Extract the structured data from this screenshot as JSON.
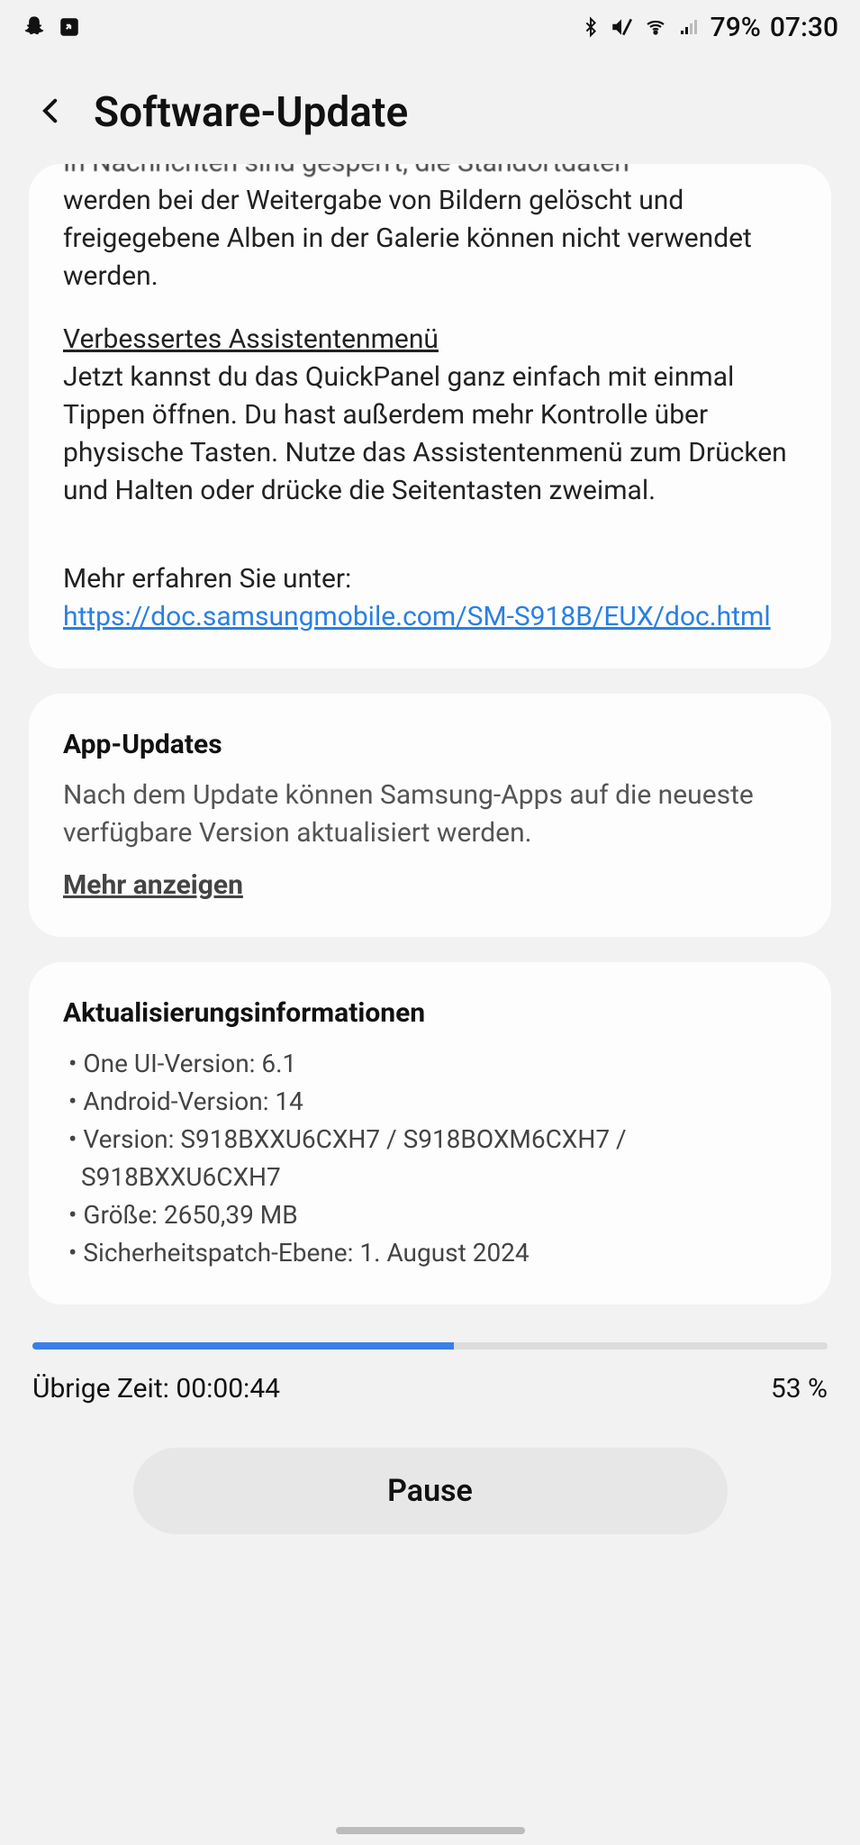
{
  "statusbar": {
    "battery": "79%",
    "time": "07:30"
  },
  "header": {
    "title": "Software-Update"
  },
  "changelog": {
    "clipped_line": "In Nachrichten sind gesperrt, die Standortdaten",
    "p1": "werden bei der Weitergabe von Bildern gelöscht und freigegebene Alben in der Galerie können nicht verwendet werden.",
    "h1": "Verbessertes Assistentenmenü",
    "p2": "Jetzt kannst du das QuickPanel ganz einfach mit einmal Tippen öffnen. Du hast außerdem mehr Kontrolle über physische Tasten. Nutze das Assistentenmenü zum Drücken und Halten oder drücke die Seitentasten zweimal.",
    "more_prefix": "Mehr erfahren Sie unter: ",
    "more_link": "https://doc.samsungmobile.com/SM-S918B/EUX/doc.html"
  },
  "appupdates": {
    "title": "App-Updates",
    "body": "Nach dem Update können Samsung-Apps auf die neueste verfügbare Version aktualisiert werden.",
    "show_more": "Mehr anzeigen"
  },
  "updateinfo": {
    "title": "Aktualisierungsinformationen",
    "oneui": "• One UI-Version: 6.1",
    "android": "• Android-Version: 14",
    "version": "• Version: S918BXXU6CXH7 / S918BOXM6CXH7 / S918BXXU6CXH7",
    "size": "• Größe: 2650,39 MB",
    "patch": "• Sicherheitspatch-Ebene: 1. August 2024"
  },
  "progress": {
    "remaining_label": "Übrige Zeit: 00:00:44",
    "percent_label": "53 %",
    "percent": 53
  },
  "buttons": {
    "pause": "Pause"
  }
}
